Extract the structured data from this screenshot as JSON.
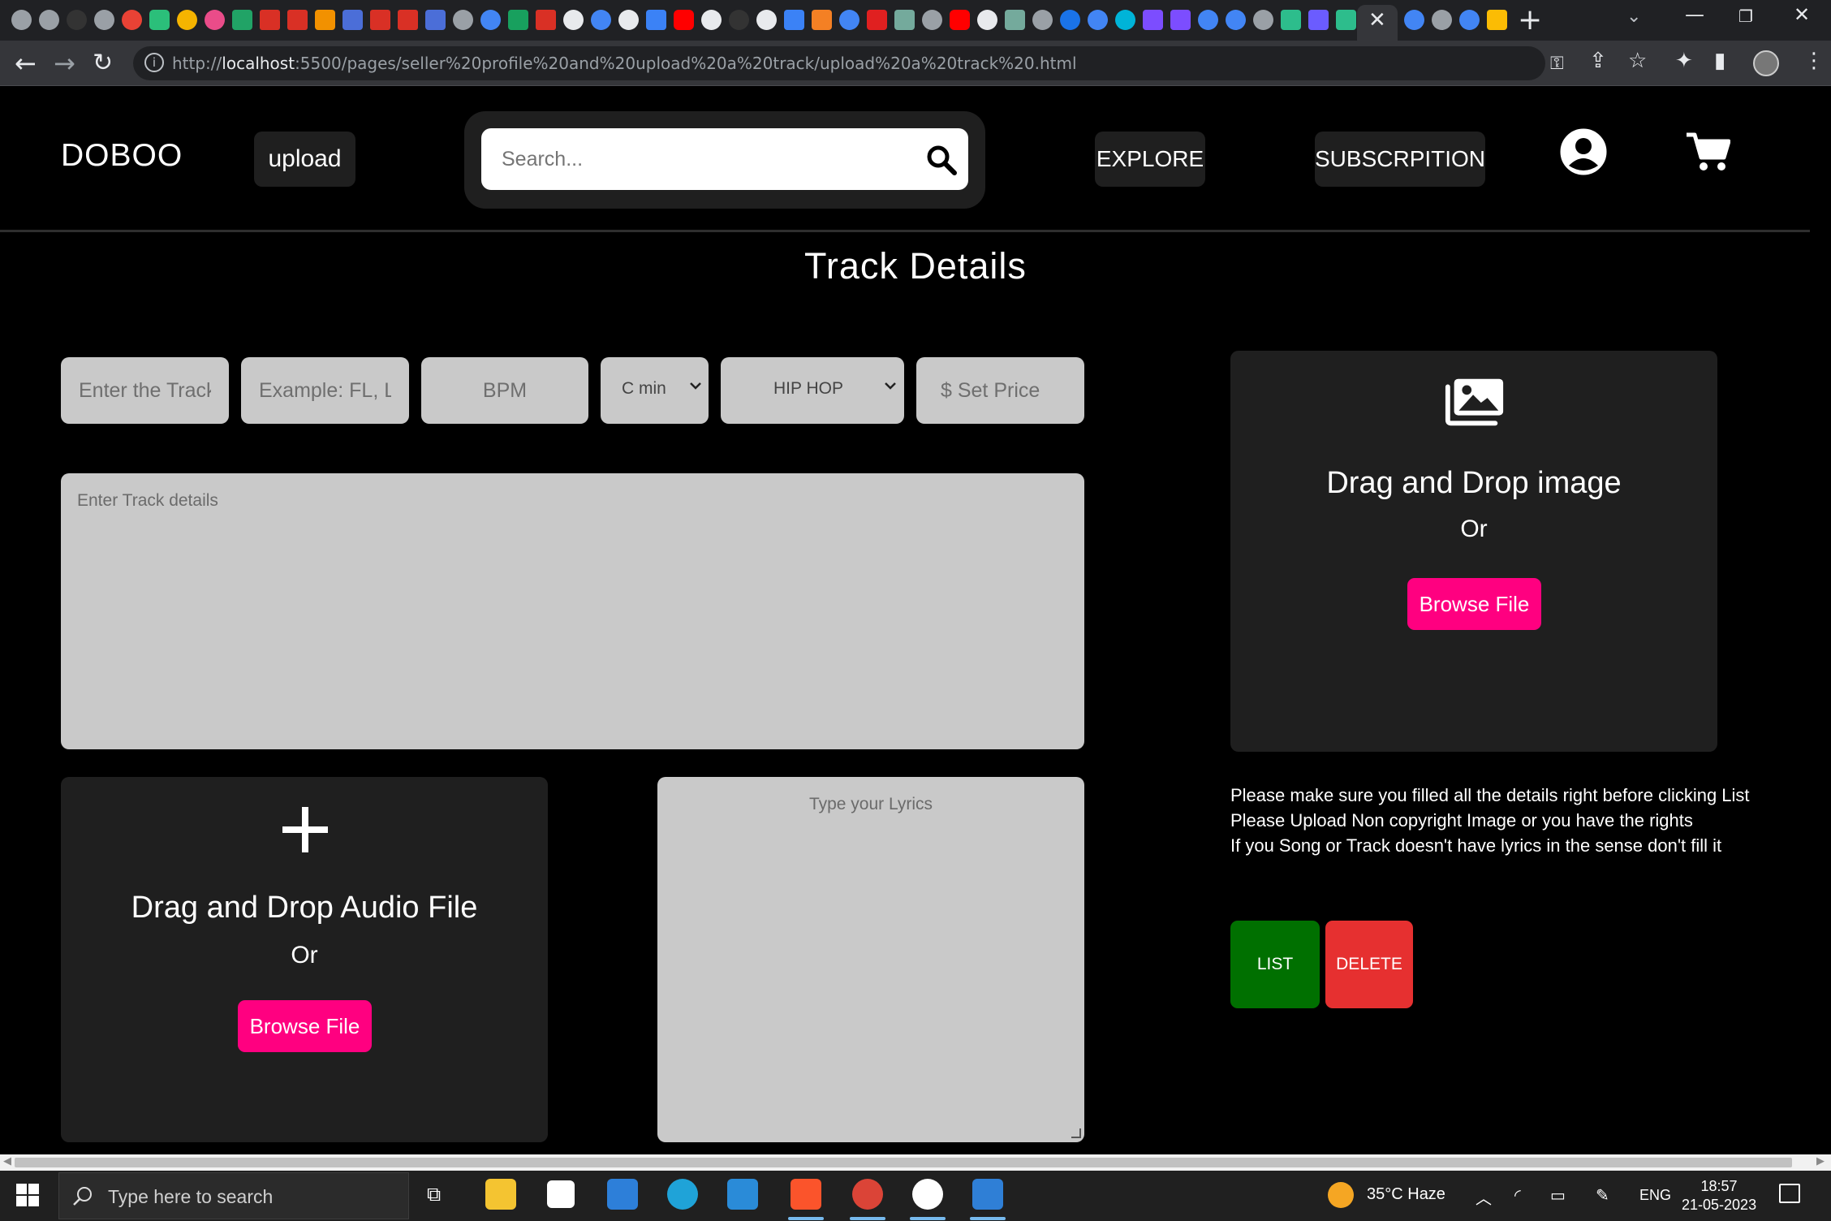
{
  "browser": {
    "url_prefix": "http://",
    "url_host": "localhost",
    "url_rest": ":5500/pages/seller%20profile%20and%20upload%20a%20track/upload%20a%20track%20.html",
    "tab_close": "✕",
    "new_tab": "+"
  },
  "header": {
    "logo": "DOBOO",
    "upload_label": "upload",
    "search_placeholder": "Search...",
    "explore_label": "EXPLORE",
    "subscription_label": "SUBSCRPITION"
  },
  "main": {
    "title": "Track Details",
    "track_name_placeholder": "Enter the Track Name",
    "daw_placeholder": "Example: FL, Logic",
    "bpm_placeholder": "BPM",
    "key_selected": "C min",
    "genre_selected": "HIP HOP",
    "price_placeholder": "$ Set Price",
    "details_placeholder": "Enter Track details",
    "lyrics_placeholder": "Type your Lyrics"
  },
  "audio_drop": {
    "title": "Drag and Drop Audio File",
    "or": "Or",
    "browse_label": "Browse File"
  },
  "image_drop": {
    "title": "Drag and Drop image",
    "or": "Or",
    "browse_label": "Browse File"
  },
  "notes": {
    "line1": "Please make sure you filled all the details right before clicking List",
    "line2": "Please Upload Non copyright Image or you have the rights",
    "line3": "If you Song or Track doesn't have lyrics in the sense don't fill it"
  },
  "actions": {
    "list_label": "LIST",
    "delete_label": "DELETE"
  },
  "taskbar": {
    "search_placeholder": "Type here to search",
    "weather": "35°C  Haze",
    "language": "ENG",
    "time": "18:57",
    "date": "21-05-2023"
  },
  "colors": {
    "accent_pink": "#ff0080",
    "list_green": "#007000",
    "delete_red": "#e63030",
    "card_bg": "#1f1f1f",
    "field_bg": "#c9c9c9"
  }
}
